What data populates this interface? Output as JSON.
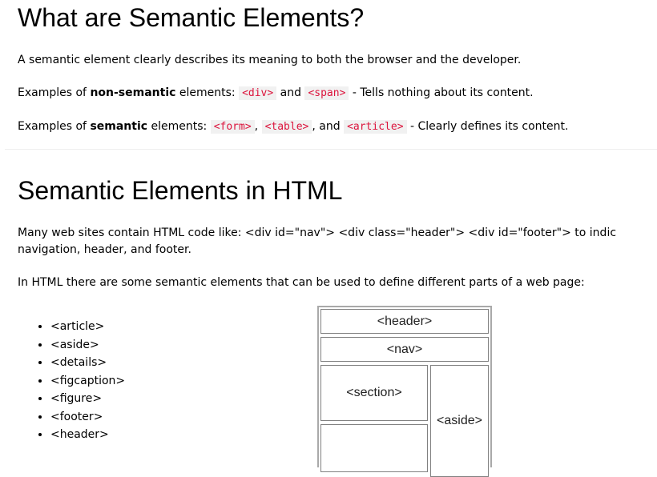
{
  "section1": {
    "title": "What are Semantic Elements?",
    "intro": "A semantic element clearly describes its meaning to both the browser and the developer.",
    "nonsem": {
      "prefix": "Examples of ",
      "bold": "non-semantic",
      "mid": " elements: ",
      "code1": "<div>",
      "and": " and ",
      "code2": "<span>",
      "suffix": " - Tells nothing about its content."
    },
    "sem": {
      "prefix": "Examples of ",
      "bold": "semantic",
      "mid": " elements: ",
      "code1": "<form>",
      "comma": ", ",
      "code2": "<table>",
      "and": ", and ",
      "code3": "<article>",
      "suffix": " - Clearly defines its content."
    }
  },
  "section2": {
    "title": "Semantic Elements in HTML",
    "para1_line1": "Many web sites contain HTML code like: <div id=\"nav\"> <div class=\"header\"> <div id=\"footer\"> to indic",
    "para1_line2": "navigation, header, and footer.",
    "para2": "In HTML there are some semantic elements that can be used to define different parts of a web page:",
    "list": [
      "<article>",
      "<aside>",
      "<details>",
      "<figcaption>",
      "<figure>",
      "<footer>",
      "<header>"
    ],
    "diagram": {
      "header": "<header>",
      "nav": "<nav>",
      "section": "<section>",
      "aside": "<aside>"
    }
  }
}
